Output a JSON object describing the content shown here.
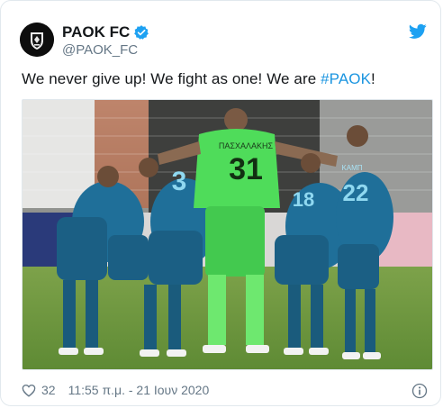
{
  "tweet": {
    "display_name": "PAOK FC",
    "handle": "@PAOK_FC",
    "text_prefix": "We never give up! We fight as one! We are ",
    "hashtag": "#PAOK",
    "text_suffix": "!",
    "like_count": "32",
    "timestamp": "11:55 π.μ. - 21 Ιουν 2020"
  },
  "photo": {
    "jersey_numbers": [
      "31",
      "3",
      "18",
      "22"
    ],
    "keeper_name": "ΠΑΣΧΑΛΑΚΗΣ",
    "number_22_name": "ΚΑΜΠ"
  },
  "icons": {
    "avatar": "paok-crest-icon",
    "verified": "verified-badge-icon",
    "brand": "twitter-bird-icon",
    "like": "heart-icon",
    "info": "info-icon"
  },
  "colors": {
    "text": "#14171a",
    "secondary": "#657786",
    "link": "#1b95e0",
    "verified": "#1da1f2",
    "border": "#e1e8ed"
  }
}
